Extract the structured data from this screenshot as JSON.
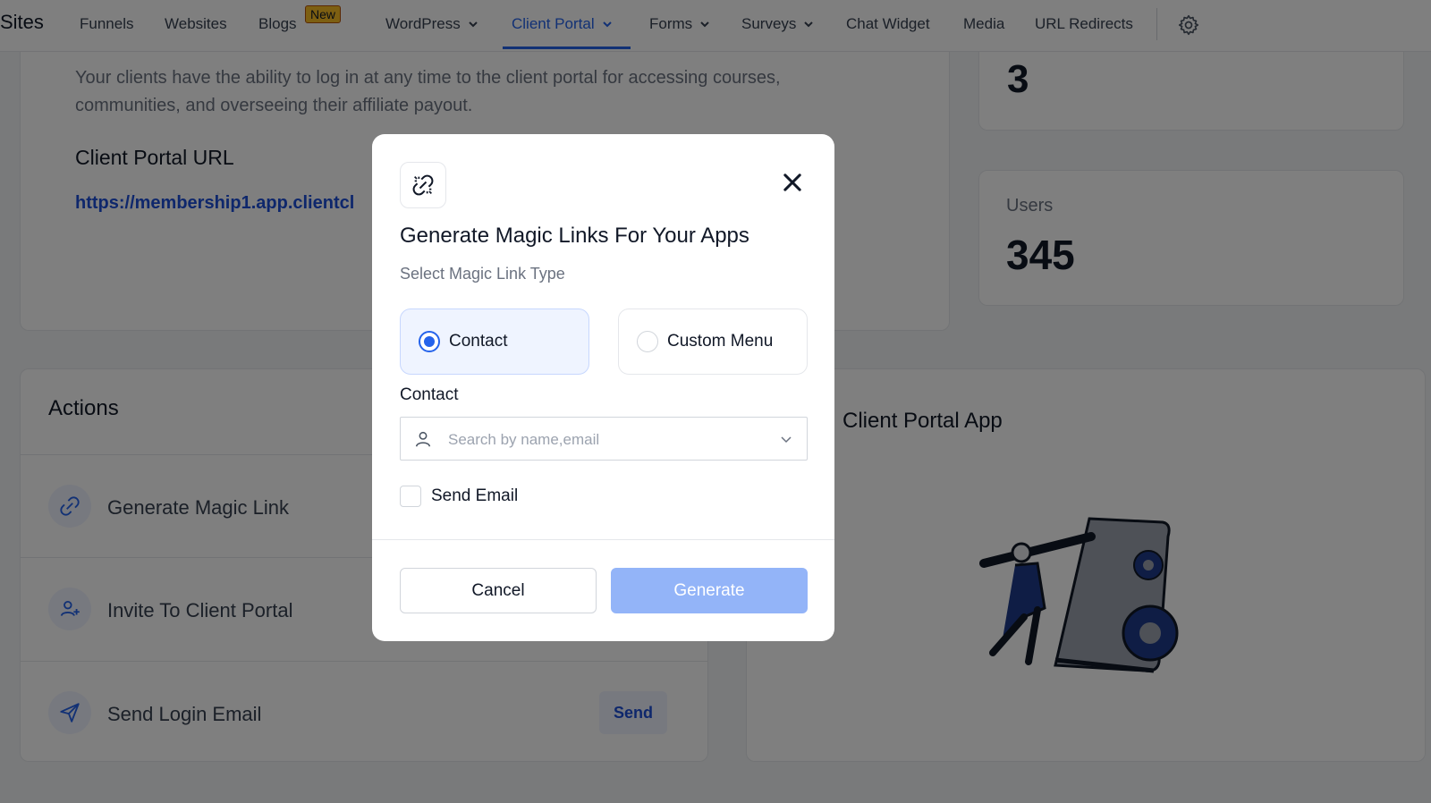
{
  "nav": {
    "brand": "Sites",
    "items": [
      {
        "label": "Funnels"
      },
      {
        "label": "Websites"
      },
      {
        "label": "Blogs",
        "badge": "New"
      },
      {
        "label": "WordPress"
      },
      {
        "label": "Client Portal"
      },
      {
        "label": "Forms"
      },
      {
        "label": "Surveys"
      },
      {
        "label": "Chat Widget"
      },
      {
        "label": "Media"
      },
      {
        "label": "URL Redirects"
      }
    ],
    "active": "Client Portal"
  },
  "overview": {
    "intro": "Your clients have the ability to log in at any time to the client portal for accessing courses, communities, and overseeing their affiliate payout.",
    "url_heading": "Client Portal URL",
    "url": "https://membership1.app.clientcl"
  },
  "stats": {
    "top_value": "3",
    "users_label": "Users",
    "users_value": "345"
  },
  "actions": {
    "title": "Actions",
    "items": [
      {
        "label": "Generate Magic Link",
        "icon": "magic-link-icon"
      },
      {
        "label": "Invite To Client Portal",
        "icon": "user-plus-icon"
      },
      {
        "label": "Send Login Email",
        "icon": "send-icon",
        "button": "Send"
      }
    ]
  },
  "app_panel": {
    "title": "Client Portal App"
  },
  "modal": {
    "title": "Generate Magic Links For Your Apps",
    "subtitle": "Select Magic Link Type",
    "options": [
      {
        "label": "Contact",
        "selected": true
      },
      {
        "label": "Custom Menu",
        "selected": false
      }
    ],
    "contact_label": "Contact",
    "search_placeholder": "Search by name,email",
    "send_email_label": "Send Email",
    "send_email_checked": false,
    "cancel_label": "Cancel",
    "generate_label": "Generate"
  },
  "colors": {
    "accent": "#2563eb",
    "generate_disabled": "#93b4f8",
    "badge": "#fbbf24"
  }
}
